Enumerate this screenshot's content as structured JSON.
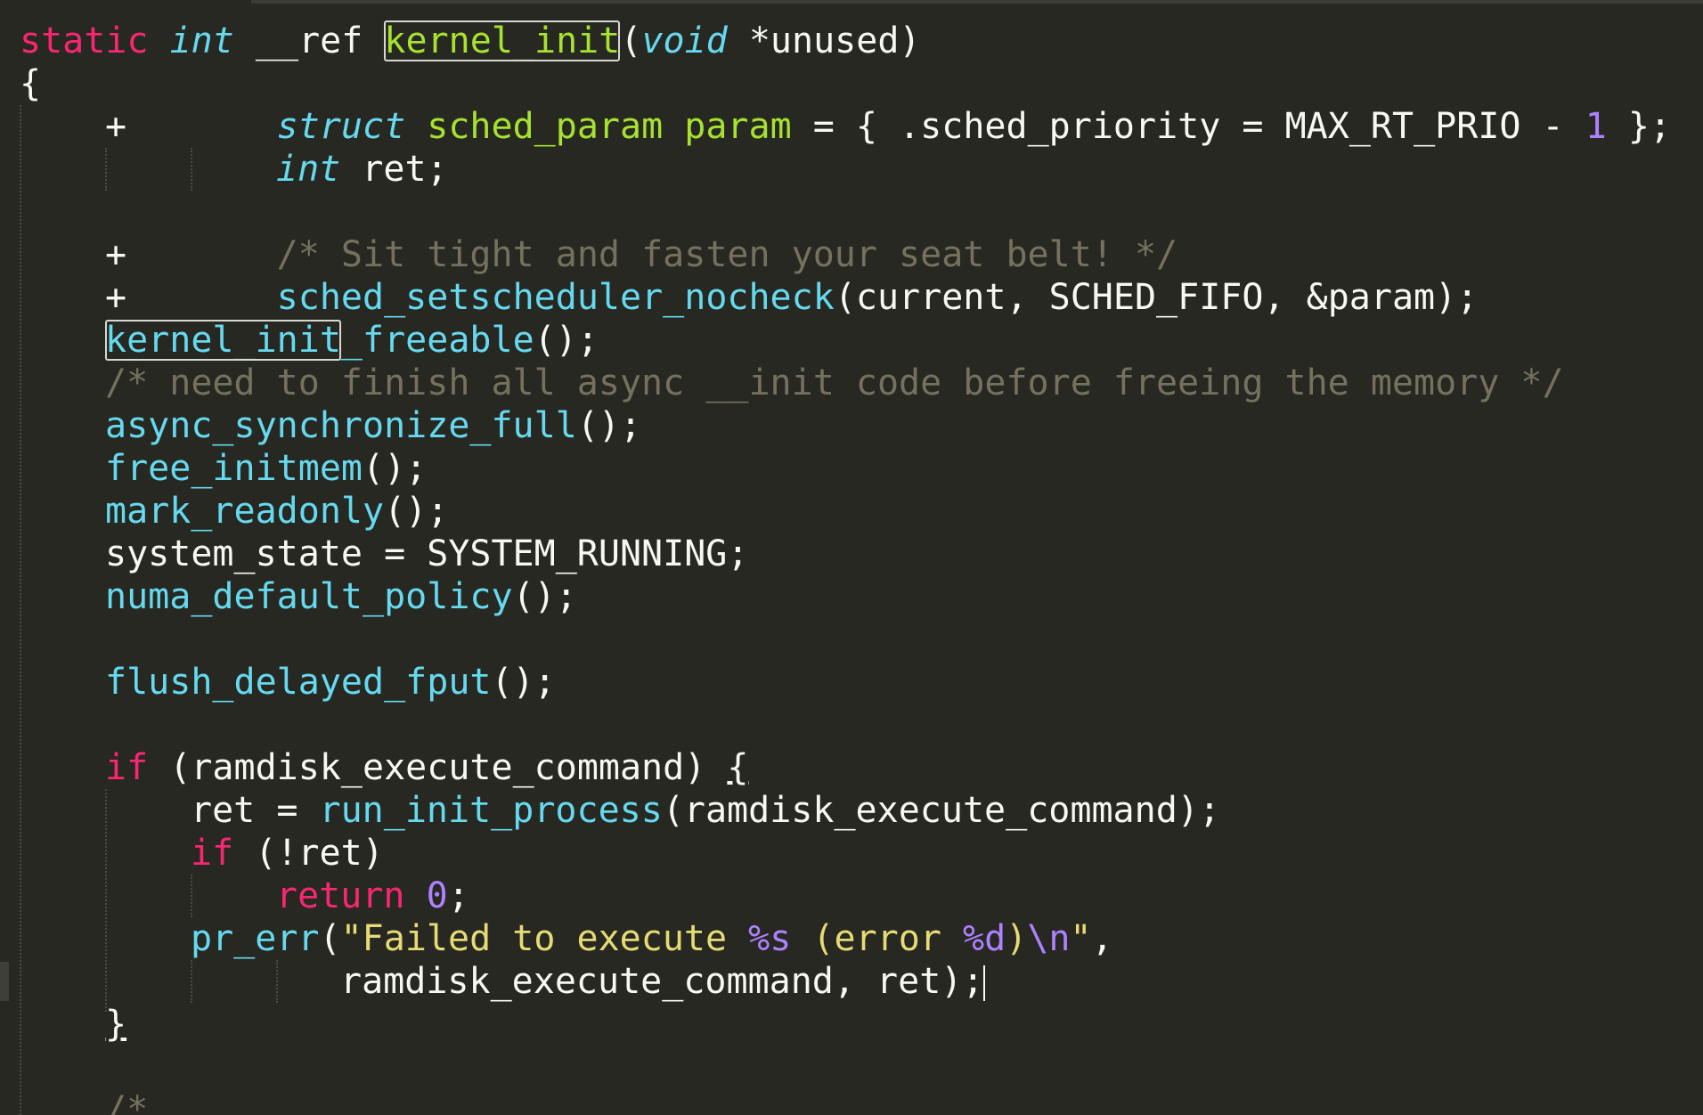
{
  "editor": {
    "theme": {
      "background": "#272822",
      "keyword": "#f92672",
      "type": "#66d9ef",
      "function": "#66d9ef",
      "name": "#a6e22e",
      "comment": "#75715e",
      "number": "#ae81ff",
      "string": "#e6db74",
      "text": "#f8f8f2"
    },
    "code": {
      "l1": {
        "kw": "static",
        "type": "int",
        "ref": " __ref ",
        "fn": "kernel_init",
        "open": "(",
        "ptype": "void",
        "param": " *unused)"
      },
      "l2": {
        "text": "{"
      },
      "l3": {
        "plus": "+",
        "kw": "struct",
        "stype": "sched_param",
        "var": "param",
        "rest1": " = { .sched_priority = MAX_RT_PRIO - ",
        "num": "1",
        "rest2": " };"
      },
      "l4": {
        "type": "int",
        "rest": " ret;"
      },
      "l6": {
        "plus": "+",
        "comment": "/* Sit tight and fasten your seat belt! */"
      },
      "l7": {
        "plus": "+",
        "fn": "sched_setscheduler_nocheck",
        "rest": "(current, SCHED_FIFO, &param);"
      },
      "l8": {
        "fn_boxed": "kernel_init",
        "fn_rest": "_freeable",
        "rest": "();"
      },
      "l9": {
        "comment": "/* need to finish all async __init code before freeing the memory */"
      },
      "l10": {
        "fn": "async_synchronize_full",
        "rest": "();"
      },
      "l11": {
        "fn": "free_initmem",
        "rest": "();"
      },
      "l12": {
        "fn": "mark_readonly",
        "rest": "();"
      },
      "l13": {
        "text": "system_state = SYSTEM_RUNNING;"
      },
      "l14": {
        "fn": "numa_default_policy",
        "rest": "();"
      },
      "l16": {
        "fn": "flush_delayed_fput",
        "rest": "();"
      },
      "l18": {
        "kw": "if",
        "rest": " (ramdisk_execute_command) ",
        "brace": "{"
      },
      "l19": {
        "pre": "ret = ",
        "fn": "run_init_process",
        "rest": "(ramdisk_execute_command);"
      },
      "l20": {
        "kw": "if",
        "rest": " (!ret)"
      },
      "l21": {
        "kw": "return",
        "sp": " ",
        "num": "0",
        "rest": ";"
      },
      "l22": {
        "fn": "pr_err",
        "open": "(",
        "str1": "\"Failed to execute ",
        "fmt1": "%s",
        "str2": " (error ",
        "fmt2": "%d",
        "str3": ")",
        "esc": "\\n",
        "str4": "\"",
        "rest": ","
      },
      "l23": {
        "text": "ramdisk_execute_command, ret);"
      },
      "l24": {
        "brace": "}"
      },
      "l26": {
        "comment": "/*"
      }
    }
  }
}
